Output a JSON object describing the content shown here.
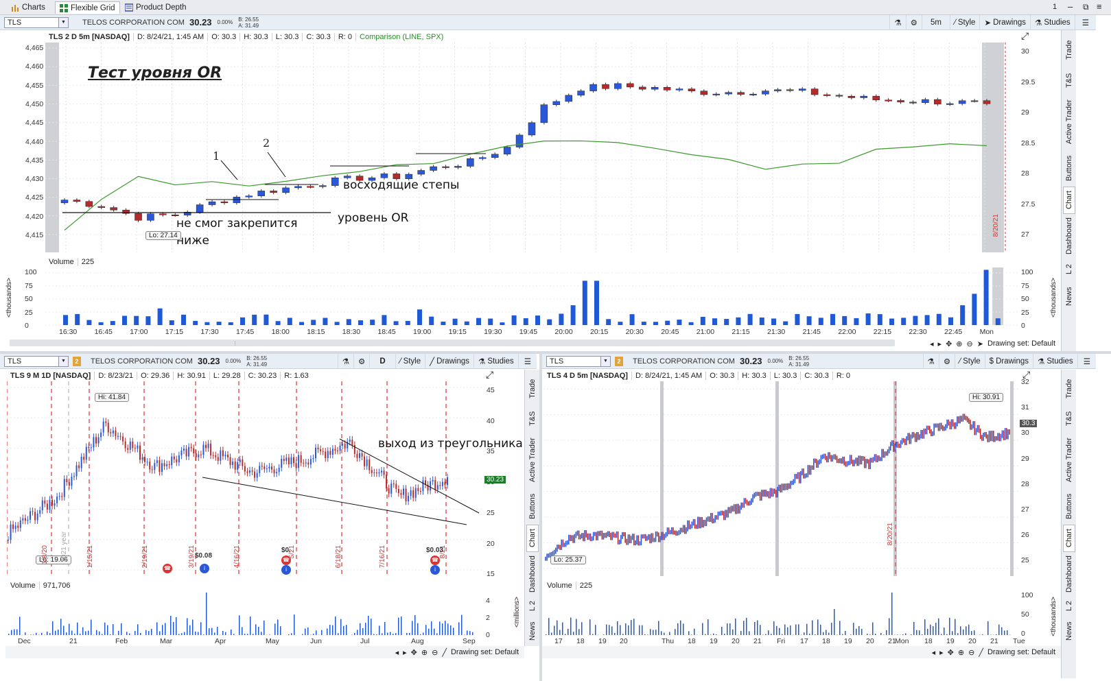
{
  "top_tabs": [
    {
      "label": "Charts"
    },
    {
      "label": "Flexible Grid"
    },
    {
      "label": "Product Depth"
    }
  ],
  "window_controls": {
    "number": "1"
  },
  "main": {
    "symbol": "TLS",
    "link": "2",
    "company": "TELOS CORPORATION COM",
    "price": "30.23",
    "change": "0.00%",
    "bid": "B: 26.55",
    "ask": "A: 31.49",
    "aggregation": "5m",
    "buttons": {
      "style": "Style",
      "drawings": "Drawings",
      "studies": "Studies"
    },
    "info": {
      "desc": "TLS 2 D 5m [NASDAQ]",
      "date": "D: 8/24/21, 1:45 AM",
      "open": "O: 30.3",
      "high": "H: 30.3",
      "low": "L: 30.3",
      "close": "C: 30.3",
      "range": "R: 0",
      "comparison": "Comparison (LINE, SPX)"
    },
    "left_axis": [
      "4,465",
      "4,460",
      "4,455",
      "4,450",
      "4,445",
      "4,440",
      "4,435",
      "4,430",
      "4,425",
      "4,420",
      "4,415"
    ],
    "right_axis": [
      "30",
      "29.5",
      "29",
      "28.5",
      "28",
      "27.5",
      "27"
    ],
    "time_axis": [
      "16:30",
      "16:45",
      "17:00",
      "17:15",
      "17:30",
      "17:45",
      "18:00",
      "18:15",
      "18:30",
      "18:45",
      "19:00",
      "19:15",
      "19:30",
      "19:45",
      "20:00",
      "20:15",
      "20:30",
      "20:45",
      "21:00",
      "21:15",
      "21:30",
      "21:45",
      "22:00",
      "22:15",
      "22:30",
      "22:45",
      "Mon"
    ],
    "lo_bubble": "Lo: 27.14",
    "date_marker": "8/20/21",
    "volume_label": "Volume",
    "volume_value": "225",
    "volume_axis": [
      "100",
      "75",
      "50",
      "25",
      "0"
    ],
    "volume_unit": "<thousands>",
    "drawing_set": "Drawing set: Default",
    "annotations": {
      "title": "Тест уровня OR",
      "label1": "1",
      "label2": "2",
      "steps": "восходящие степы",
      "or_level": "уровень OR",
      "failed_line1": "не смог закрепится",
      "failed_line2": "ниже"
    }
  },
  "side_tabs": [
    "Trade",
    "T&S",
    "Active Trader",
    "Buttons",
    "Chart",
    "Dashboard",
    "L 2",
    "News"
  ],
  "bottom_left": {
    "symbol": "TLS",
    "link": "2",
    "company": "TELOS CORPORATION COM",
    "price": "30.23",
    "change": "0.00%",
    "bid": "B: 26.55",
    "ask": "A: 31.49",
    "aggregation": "D",
    "buttons": {
      "style": "Style",
      "drawings": "Drawings",
      "studies": "Studies"
    },
    "info": {
      "desc": "TLS 9 M 1D [NASDAQ]",
      "date": "D: 8/23/21",
      "open": "O: 29.36",
      "high": "H: 30.91",
      "low": "L: 29.28",
      "close": "C: 30.23",
      "range": "R: 1.63"
    },
    "price_axis": [
      "45",
      "40",
      "35",
      "30",
      "25",
      "20",
      "15"
    ],
    "price_tag": "30.23",
    "hi_bubble": "Hi: 41.84",
    "lo_bubble": "Lo: 19.06",
    "date_markers": [
      "1/8/20",
      "1/15/21",
      "2/19/21",
      "3/19/21",
      "4/16/21",
      "5/21",
      "6/18/21",
      "7/16/21",
      "8/21"
    ],
    "year_marker": "2021 year",
    "dividends": [
      "$0.08",
      "$0.",
      "$0.03"
    ],
    "annotation": "выход из треугольника",
    "time_axis": [
      "Dec",
      "21",
      "Feb",
      "Mar",
      "Apr",
      "May",
      "Jun",
      "Jul",
      "Aug",
      "Sep"
    ],
    "volume_label": "Volume",
    "volume_value": "971,706",
    "volume_axis": [
      "4",
      "2",
      "0"
    ],
    "volume_unit": "<millions>",
    "drawing_set": "Drawing set: Default"
  },
  "bottom_right": {
    "symbol": "TLS",
    "link": "2",
    "company": "TELOS CORPORATION COM",
    "price": "30.23",
    "change": "0.00%",
    "bid": "B: 26.55",
    "ask": "A: 31.49",
    "buttons": {
      "style": "Style",
      "drawings": "Drawings",
      "studies": "Studies"
    },
    "info": {
      "desc": "TLS 4 D 5m [NASDAQ]",
      "date": "D: 8/24/21, 1:45 AM",
      "open": "O: 30.3",
      "high": "H: 30.3",
      "low": "L: 30.3",
      "close": "C: 30.3",
      "range": "R: 0"
    },
    "price_axis": [
      "32",
      "31",
      "30",
      "29",
      "28",
      "27",
      "26",
      "25"
    ],
    "price_tag": "30.3",
    "hi_bubble": "Hi: 30.91",
    "lo_bubble": "Lo: 25.37",
    "date_marker": "8/20/21",
    "time_axis": [
      "17",
      "18",
      "19",
      "20",
      "Thu",
      "18",
      "19",
      "20",
      "21",
      "Fri",
      "17",
      "18",
      "19",
      "20",
      "21",
      "Mon",
      "18",
      "19",
      "20",
      "21",
      "Tue"
    ],
    "volume_label": "Volume",
    "volume_value": "225",
    "volume_axis": [
      "100",
      "50",
      "0"
    ],
    "volume_unit": "<thousands>",
    "drawing_set": "Drawing set: Default"
  },
  "colors": {
    "up": "#2b57d9",
    "down": "#b52a2a",
    "comparison": "#3a9a2a",
    "volume": "#1f5ad6",
    "marker": "#d33"
  },
  "chart_data": [
    {
      "type": "candlestick",
      "title": "TLS 2 D 5m [NASDAQ]",
      "x": [
        "16:30",
        "16:45",
        "17:00",
        "17:15",
        "17:30",
        "17:45",
        "18:00",
        "18:15",
        "18:30",
        "18:45",
        "19:00",
        "19:15",
        "19:30",
        "19:45",
        "20:00",
        "20:15",
        "20:30",
        "20:45",
        "21:00",
        "21:15",
        "21:30",
        "21:45",
        "22:00",
        "22:15",
        "22:30",
        "22:45"
      ],
      "series": [
        {
          "name": "TLS",
          "close": [
            27.6,
            27.5,
            27.3,
            27.35,
            27.55,
            27.7,
            27.8,
            27.9,
            27.98,
            28.0,
            28.15,
            28.25,
            28.5,
            29.2,
            29.52,
            29.55,
            29.52,
            29.45,
            29.45,
            29.48,
            29.45,
            29.38,
            29.32,
            29.3,
            29.28,
            29.25
          ]
        },
        {
          "name": "Comparison (LINE, SPX)",
          "values": [
            4418,
            4426,
            4432,
            4430,
            4431,
            4430,
            4432,
            4433,
            4434,
            4436,
            4436,
            4438,
            4440,
            4442,
            4441,
            4442,
            4440,
            4438,
            4437,
            4435,
            4435,
            4436,
            4439,
            4440,
            4441,
            4441
          ]
        }
      ],
      "ylim_left": [
        4413,
        4467
      ],
      "ylim_right": [
        26.7,
        30.3
      ]
    },
    {
      "type": "candlestick",
      "title": "TLS 9 M 1D [NASDAQ]",
      "x": [
        "Dec",
        "21",
        "Feb",
        "Mar",
        "Apr",
        "May",
        "Jun",
        "Jul",
        "Aug",
        "Sep"
      ],
      "series": [
        {
          "name": "TLS",
          "close": [
            21,
            27,
            39,
            32,
            35,
            31,
            33,
            36,
            27,
            30.23
          ]
        }
      ],
      "ylim": [
        14,
        46
      ]
    },
    {
      "type": "candlestick",
      "title": "TLS 4 D 5m [NASDAQ]",
      "x": [
        "17",
        "18",
        "19",
        "20",
        "Thu",
        "18",
        "19",
        "20",
        "21",
        "Fri",
        "17",
        "18",
        "19",
        "20",
        "21",
        "Mon",
        "18",
        "19",
        "20",
        "21",
        "Tue"
      ],
      "series": [
        {
          "name": "TLS",
          "close": [
            25.5,
            26.2,
            26.3,
            26.2,
            26.1,
            26.3,
            26.6,
            26.9,
            27.2,
            27.8,
            28.0,
            28.6,
            29.4,
            29.2,
            29.1,
            29.8,
            30.2,
            30.5,
            30.8,
            30.1,
            30.3
          ]
        }
      ],
      "ylim": [
        24.7,
        32.3
      ]
    }
  ]
}
